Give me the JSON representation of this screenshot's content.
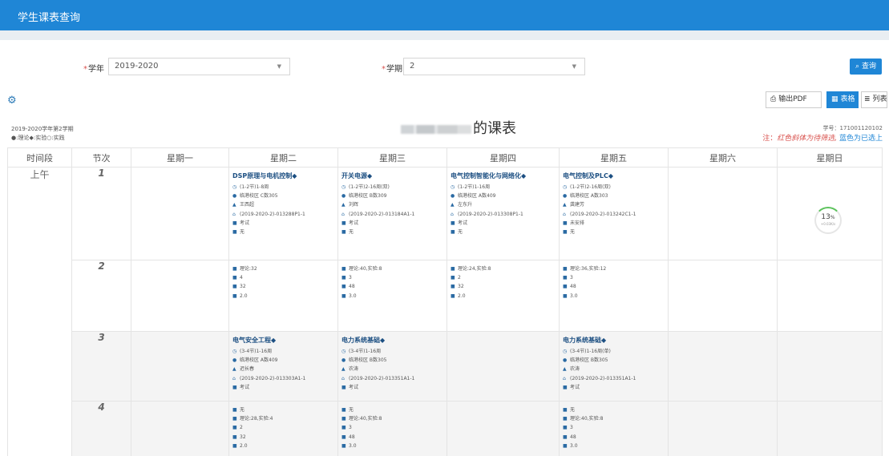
{
  "window_title": "学生课表查询",
  "form": {
    "year_label": "学年",
    "year_value": "2019-2020",
    "term_label": "学期",
    "term_value": "2",
    "query_button": "查询"
  },
  "toolbar": {
    "export_pdf": "输出PDF",
    "table_view": "表格",
    "list_view": "列表"
  },
  "info": {
    "term_text": "2019-2020学年第2学期",
    "legend_text": "●:理论◆:实验○:实践",
    "title_suffix": "的课表",
    "student_no": "学号：171001120102",
    "note_prefix": "注：",
    "note_red": "红色斜体为待筛选,",
    "note_blue": "蓝色为已选上"
  },
  "columns": [
    "时间段",
    "节次",
    "星期一",
    "星期二",
    "星期三",
    "星期四",
    "星期五",
    "星期六",
    "星期日"
  ],
  "period_label": "上午",
  "slots": [
    "1",
    "2",
    "3",
    "4"
  ],
  "courses": {
    "tue_12": {
      "name": "DSP原理与电机控制◆",
      "time": "(1-2节)1-8周",
      "place": "临港校区 C数305",
      "teacher": "王西超",
      "code": "(2019-2020-2)-013288P1-1",
      "exam": "考试",
      "extra": "无",
      "hours": "理论:32",
      "n1": "4",
      "n2": "32",
      "credit": "2.0"
    },
    "wed_12": {
      "name": "开关电源◆",
      "time": "(1-2节)2-16周(双)",
      "place": "临港校区 B数309",
      "teacher": "刘辉",
      "code": "(2019-2020-2)-013184A1-1",
      "exam": "考试",
      "extra": "无",
      "hours": "理论:40,实验:8",
      "n1": "3",
      "n2": "48",
      "credit": "3.0"
    },
    "thu_12": {
      "name": "电气控制智能化与网络化◆",
      "time": "(1-2节)1-16周",
      "place": "临港校区 A数409",
      "teacher": "左东升",
      "code": "(2019-2020-2)-013308P1-1",
      "exam": "考试",
      "extra": "无",
      "hours": "理论:24,实验:8",
      "n1": "2",
      "n2": "32",
      "credit": "2.0"
    },
    "fri_12": {
      "name": "电气控制及PLC◆",
      "time": "(1-2节)2-16周(双)",
      "place": "临港校区 A数303",
      "teacher": "龚建芳",
      "code": "(2019-2020-2)-013242C1-1",
      "exam": "未安排",
      "extra": "无",
      "hours": "理论:36,实验:12",
      "n1": "3",
      "n2": "48",
      "credit": "3.0"
    },
    "tue_34": {
      "name": "电气安全工程◆",
      "time": "(3-4节)1-16周",
      "place": "临港校区 A数409",
      "teacher": "迟长春",
      "code": "(2019-2020-2)-013303A1-1",
      "exam": "考试",
      "extra": "无",
      "hours": "理论:28,实验:4",
      "n1": "2",
      "n2": "32",
      "credit": "2.0"
    },
    "wed_34": {
      "name": "电力系统基础◆",
      "time": "(3-4节)1-16周",
      "place": "临港校区 B数305",
      "teacher": "农涛",
      "code": "(2019-2020-2)-013351A1-1",
      "exam": "考试",
      "extra": "无",
      "hours": "理论:40,实验:8",
      "n1": "3",
      "n2": "48",
      "credit": "3.0"
    },
    "fri_34": {
      "name": "电力系统基础◆",
      "time": "(3-4节)1-16周(单)",
      "place": "临港校区 B数305",
      "teacher": "农涛",
      "code": "(2019-2020-2)-013351A1-1",
      "exam": "考试",
      "extra": "无",
      "hours": "理论:40,实验:8",
      "n1": "3",
      "n2": "48",
      "credit": "3.0"
    }
  },
  "progress": {
    "value": "13",
    "unit": "%",
    "speed": "+0.03K/s",
    "fraction": 0.13
  },
  "colors": {
    "topbar": "#1f86d6",
    "course_name": "#1c4f82",
    "note_red": "#d9534f",
    "note_blue": "#1f86d6",
    "progress": "#5ec35e"
  }
}
